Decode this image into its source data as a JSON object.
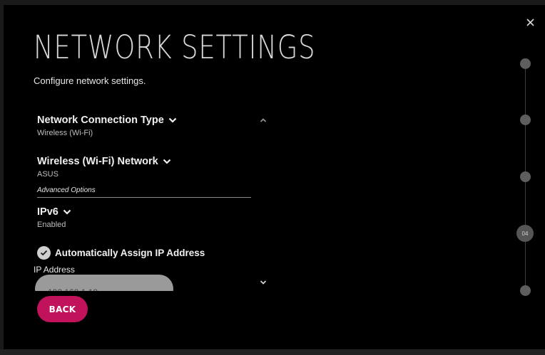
{
  "page": {
    "title": "NETWORK SETTINGS",
    "subtitle": "Configure network settings."
  },
  "fields": {
    "connection_type": {
      "label": "Network Connection Type",
      "value": "Wireless (Wi-Fi)"
    },
    "wifi_network": {
      "label": "Wireless (Wi-Fi) Network",
      "value": "ASUS"
    },
    "advanced_options": "Advanced Options",
    "ipv6": {
      "label": "IPv6",
      "value": "Enabled"
    },
    "auto_ip": {
      "label": "Automatically Assign IP Address",
      "checked": true
    },
    "ip_address": {
      "label": "IP Address",
      "value": "192.168.1.18"
    }
  },
  "buttons": {
    "back": "BACK"
  },
  "stepper": {
    "current_label": "04"
  },
  "colors": {
    "accent": "#c0135b",
    "background": "#000000",
    "stepper_dot": "#5e5e5e"
  },
  "icons": {
    "close": "close-icon",
    "chevron_down": "chevron-down-icon",
    "chevron_up": "chevron-up-icon",
    "check": "check-icon"
  }
}
